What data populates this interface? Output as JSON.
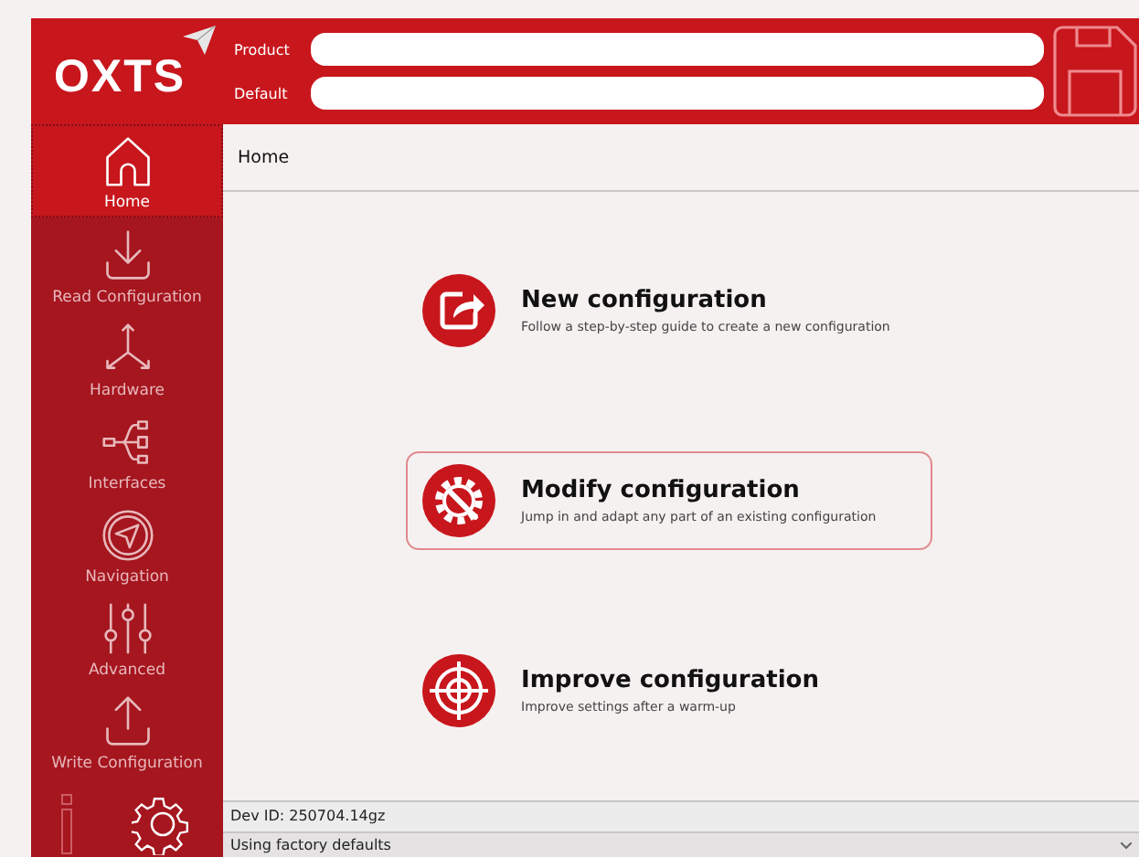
{
  "header": {
    "logo": "OXTS",
    "fields": [
      {
        "label": "Product"
      },
      {
        "label": "Default"
      }
    ]
  },
  "sidebar": {
    "items": [
      {
        "label": "Home",
        "selected": true
      },
      {
        "label": "Read Configuration",
        "selected": false
      },
      {
        "label": "Hardware",
        "selected": false
      },
      {
        "label": "Interfaces",
        "selected": false
      },
      {
        "label": "Navigation",
        "selected": false
      },
      {
        "label": "Advanced",
        "selected": false
      },
      {
        "label": "Write Configuration",
        "selected": false
      }
    ]
  },
  "breadcrumb": "Home",
  "options": [
    {
      "title": "New configuration",
      "description": "Follow a step-by-step guide to create a new configuration",
      "selected": false
    },
    {
      "title": "Modify configuration",
      "description": "Jump in and adapt any part of an existing configuration",
      "selected": true
    },
    {
      "title": "Improve configuration",
      "description": "Improve settings after a warm-up",
      "selected": false
    }
  ],
  "status_bar": {
    "dev_id": "Dev ID: 250704.14gz",
    "defaults": "Using factory defaults"
  }
}
